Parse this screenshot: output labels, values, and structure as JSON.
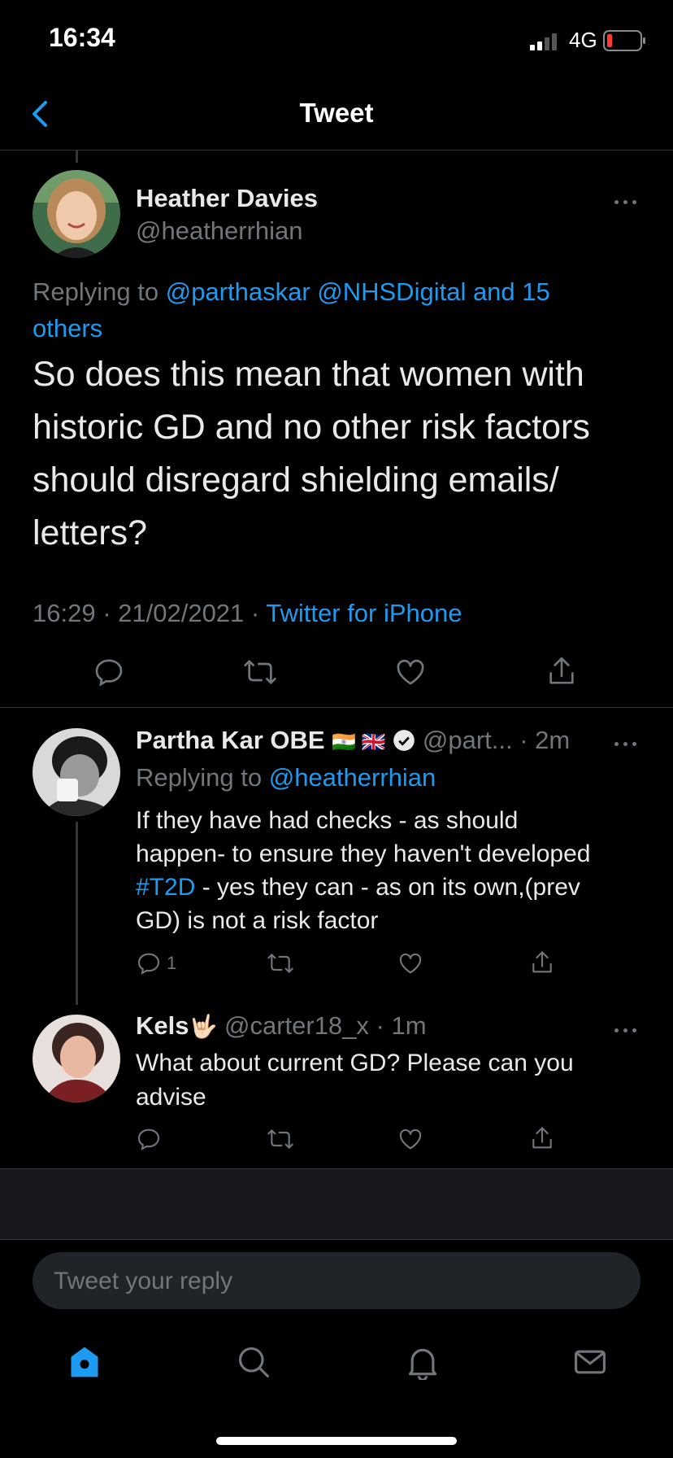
{
  "status_bar": {
    "time": "16:34",
    "network": "4G"
  },
  "nav": {
    "title": "Tweet"
  },
  "main_tweet": {
    "author_name": "Heather Davies",
    "handle": "@heatherrhian",
    "replying_prefix": "Replying to ",
    "replying_to_line1": "@parthaskar @NHSDigital and 15",
    "replying_to_line2": "others",
    "text_lines": [
      "So does this mean that women with",
      "historic GD and no other risk factors",
      "should disregard shielding emails/",
      "letters?"
    ],
    "time": "16:29",
    "date": "21/02/2021",
    "source": "Twitter for iPhone",
    "separator": " · "
  },
  "reply1": {
    "author_name": "Partha Kar OBE",
    "flags": "🇮🇳 🇬🇧",
    "handle": "@part...",
    "age": "· 2m",
    "replying_prefix": "Replying to ",
    "replying_to": "@heatherrhian",
    "text_line1": "If they have had checks - as should",
    "text_line2": "happen- to ensure they haven't developed",
    "hashtag": "#T2D",
    "text_line3_rest": " - yes they can - as on its own,(prev",
    "text_line4": "GD) is not a risk factor",
    "reply_count": "1"
  },
  "reply2": {
    "author_name": "Kels",
    "emoji": "🤟🏻",
    "handle": "@carter18_x",
    "age": "· 1m",
    "text_line1": "What about current GD? Please can you",
    "text_line2": "advise"
  },
  "composer": {
    "placeholder": "Tweet your reply"
  },
  "tab_bar": {
    "items": [
      "home-icon",
      "search-icon",
      "notifications-icon",
      "messages-icon"
    ],
    "active": "home-icon"
  },
  "colors": {
    "accent": "#1d9bf0",
    "background": "#000000",
    "secondary_text": "#71767b",
    "battery_low": "#ff3b30"
  }
}
